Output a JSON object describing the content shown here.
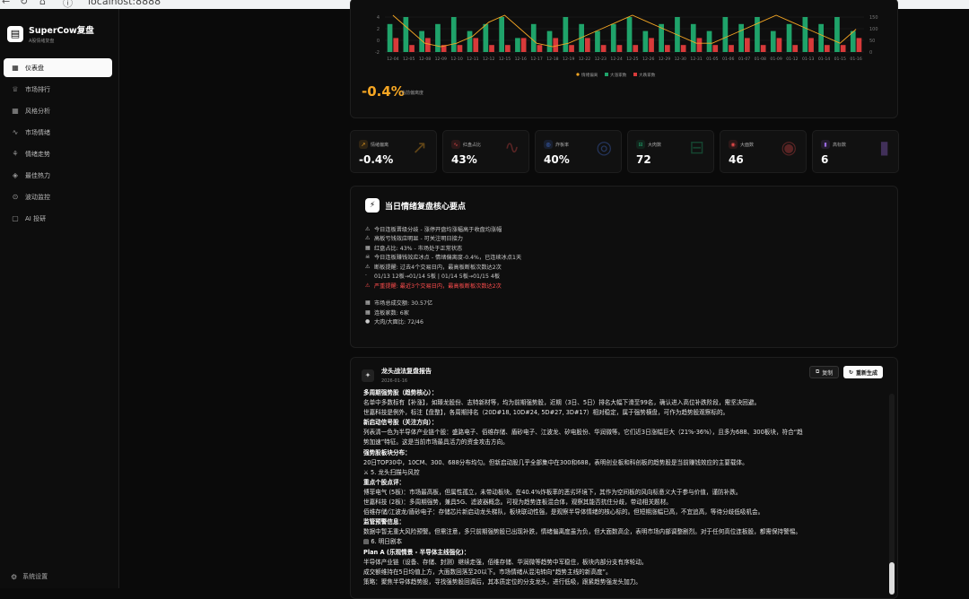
{
  "browser": {
    "url": "localhost:8888"
  },
  "brand": {
    "name": "SuperCow复盘",
    "sub": "A股情绪复盘"
  },
  "nav": [
    {
      "label": "仪表盘",
      "icon": "▦",
      "active": true
    },
    {
      "label": "市场排行",
      "icon": "♕"
    },
    {
      "label": "风格分析",
      "icon": "▦"
    },
    {
      "label": "市场情绪",
      "icon": "∿"
    },
    {
      "label": "情绪走势",
      "icon": "⚘"
    },
    {
      "label": "最佳热力",
      "icon": "◈"
    },
    {
      "label": "波动监控",
      "icon": "⊙"
    },
    {
      "label": "AI 投研",
      "icon": "▢"
    }
  ],
  "settings": {
    "label": "系统设置",
    "icon": "⚙"
  },
  "chart_data": {
    "type": "bar",
    "categories": [
      "12-04",
      "12-05",
      "12-08",
      "12-09",
      "12-10",
      "12-11",
      "12-12",
      "12-15",
      "12-16",
      "12-17",
      "12-18",
      "12-19",
      "12-22",
      "12-23",
      "12-24",
      "12-25",
      "12-26",
      "12-29",
      "12-30",
      "12-31",
      "01-05",
      "01-06",
      "01-07",
      "01-08",
      "01-09",
      "01-12",
      "01-13",
      "01-14",
      "01-15",
      "01-16"
    ],
    "series": [
      {
        "name": "大涨家数",
        "color": "#1fa36a",
        "values": [
          4,
          5,
          3,
          4,
          5,
          3,
          4,
          5,
          2,
          4,
          3,
          5,
          4,
          3,
          4,
          5,
          3,
          4,
          5,
          4,
          3,
          5,
          4,
          5,
          3,
          4,
          5,
          4,
          5,
          3
        ]
      },
      {
        "name": "大跌家数",
        "color": "#d83a3a",
        "values": [
          2,
          1,
          2,
          1,
          1,
          2,
          1,
          1,
          2,
          1,
          2,
          1,
          2,
          1,
          1,
          1,
          2,
          1,
          1,
          2,
          1,
          1,
          2,
          1,
          2,
          1,
          2,
          1,
          1,
          2
        ]
      },
      {
        "name": "情绪偏离",
        "color": "#f5a623",
        "values": [
          5,
          3,
          1,
          0.5,
          1,
          2,
          4,
          5,
          3,
          1,
          0.5,
          1,
          2,
          3,
          4,
          5,
          4,
          3,
          2,
          1,
          1,
          2,
          3,
          4,
          5,
          4,
          3,
          2,
          1,
          3
        ]
      }
    ],
    "yleft_ticks": [
      "4",
      "2",
      "0",
      "-2"
    ],
    "yright_ticks": [
      "150",
      "100",
      "50",
      "0"
    ]
  },
  "deviation": {
    "value": "-0.4%",
    "label": "当前偏离度"
  },
  "stats": [
    {
      "label": "情绪偏离",
      "value": "-0.4%",
      "icon": "↗",
      "color": "#f5a623"
    },
    {
      "label": "红盘占比",
      "value": "43%",
      "icon": "∿",
      "color": "#e04848"
    },
    {
      "label": "炸板率",
      "value": "40%",
      "icon": "◎",
      "color": "#4a7cf0"
    },
    {
      "label": "大肉数",
      "value": "72",
      "icon": "⊟",
      "color": "#1fa36a"
    },
    {
      "label": "大面数",
      "value": "46",
      "icon": "◉",
      "color": "#e04848"
    },
    {
      "label": "高标数",
      "value": "6",
      "icon": "▮",
      "color": "#9a6ae0"
    }
  ],
  "summary": {
    "title": "当日情绪复盘核心要点",
    "lines": [
      {
        "e": "⚠",
        "t": "今日连板晋级分歧 - 涨停开盘均涨幅高于收盘均涨幅"
      },
      {
        "e": "⚠",
        "t": "高板亏钱效应明显 - 可关注明日接力"
      },
      {
        "e": "▦",
        "t": "红盘占比: 43% - 市场处于正常状态"
      },
      {
        "e": "☠",
        "t": "今日连板赚钱效应冰点 - 情绪偏离度-0.4%，已连续冰点1天"
      },
      {
        "e": "⚠",
        "t": "断板提醒: 过去4个交易日内，最高板断板次数达2次"
      },
      {
        "e": "·",
        "t": "01/13 12板→01/14 5板 | 01/14 5板→01/15 4板"
      },
      {
        "e": "⚠",
        "t": "严重提醒: 最近3个交易日内，最高板断板次数达2次",
        "red": true
      },
      {
        "e": "▦",
        "t": "市场总成交额: 30.57亿",
        "gap": true
      },
      {
        "e": "▦",
        "t": "连板家数: 6家"
      },
      {
        "e": "●",
        "t": "大肉/大面比: 72/46"
      }
    ]
  },
  "report": {
    "title": "龙头战法复盘报告",
    "date": "2026-01-16",
    "copy_label": "复制",
    "regen_label": "重新生成",
    "lines": [
      {
        "t": "多周期强势股（趋势核心）：",
        "h": true
      },
      {
        "t": "名单中多数标有【补涨】，如臻龙股份、志特新材等，均为前期强势股，近期（3日、5日）排名大幅下滑至99名，确认进入高位补跌阶段，需坚决回避。"
      },
      {
        "t": "世嘉科技是例外，标注【盘整】，各周期排名（20D#18, 10D#24, 5D#27, 3D#17）相对稳定，属于强势横盘，可作为趋势股观察标的。"
      },
      {
        "t": "新启动信号股（关注方向）：",
        "h": true
      },
      {
        "t": "列表清一色为半导体产业链个股：盛路电子、佰维存储、盾砂电子、江波龙、矽电股份、华润微等。它们近3日涨幅巨大（21%-36%），且多为688、300板块，符合“趋"
      },
      {
        "t": "势加速”特征。这是当前市场最具活力的资金攻击方向。"
      },
      {
        "t": "强势股板块分布：",
        "h": true
      },
      {
        "t": "20日TOP30中，10CM、300、688分布均匀。但新启动股几乎全部集中在300和688，表明创业板和科创板的趋势股是当前赚钱效应的主要载体。"
      },
      {
        "t": "⚔ 5. 龙头扫描与风控"
      },
      {
        "t": "重点个股点评：",
        "h": true
      },
      {
        "t": "博菲电气 (5板)：市场最高板，但属性孤立，未带动板块。在40.4%炸板率的恶劣环境下，其作为空间板的风向标意义大于参与价值，谨防补跌。"
      },
      {
        "t": "世嘉科技 (2板)：多周期强势，兼具5G、滤波器概念。可视为趋势连板混合体，观察其能否抗住分歧，带动相关题材。"
      },
      {
        "t": "佰维存储/江波龙/盾砂电子：存储芯片新启动龙头梯队，板块联动性强，是观察半导体情绪的核心标的。但短期涨幅已高，不宜追高，等待分歧低吸机会。"
      },
      {
        "t": "监管预警信息：",
        "h": true
      },
      {
        "t": "数据中暂无重大风险预警。但需注意，多只前期强势股已出现补跌，情绪偏离度虽为负，但大面数高企，表明市场内部调整剧烈。对于任何高位连板股，都需保持警惕。"
      },
      {
        "t": "▤ 6. 明日剧本"
      },
      {
        "t": "Plan A (乐观情景 - 半导体主线强化)：",
        "h": true
      },
      {
        "t": "半导体产业链（设备、存储、封测）继续走强，佰维存储、华润微等趋势中军稳住，板块内部分支有序轮动。"
      },
      {
        "t": "成交额维持在5日均值上方，大面数回落至20以下。市场情绪从混沌转向“趋势主线的新高度”。"
      },
      {
        "t": "策略：聚焦半导体趋势股，寻找强势股回调后，其本质定位的分支龙头，进行低吸，跟紧趋势强龙头加力。"
      }
    ]
  }
}
